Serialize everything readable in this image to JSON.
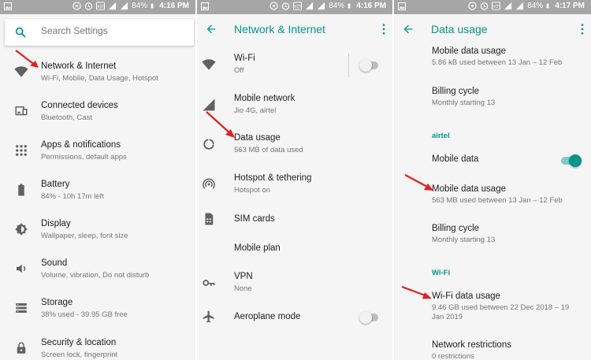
{
  "status": {
    "battery_p1": "84%",
    "time_p1": "4:16 PM",
    "battery_p2": "84%",
    "time_p2": "4:16 PM",
    "battery_p3": "84%",
    "time_p3": "4:17 PM"
  },
  "colors": {
    "accent": "#009688",
    "arrow": "#e02020",
    "statusbar": "#a6a6a6"
  },
  "settings": {
    "search_placeholder": "Search Settings",
    "items": [
      {
        "title": "Network & Internet",
        "subtitle": "Wi-Fi, Mobile, Data Usage, Hotspot",
        "icon": "wifi-icon"
      },
      {
        "title": "Connected devices",
        "subtitle": "Bluetooth, Cast",
        "icon": "devices-icon"
      },
      {
        "title": "Apps & notifications",
        "subtitle": "Permissions, default apps",
        "icon": "apps-grid-icon"
      },
      {
        "title": "Battery",
        "subtitle": "84% - 10h 17m left",
        "icon": "battery-icon"
      },
      {
        "title": "Display",
        "subtitle": "Wallpaper, sleep, font size",
        "icon": "brightness-icon"
      },
      {
        "title": "Sound",
        "subtitle": "Volume, vibration, Do not disturb",
        "icon": "volume-icon"
      },
      {
        "title": "Storage",
        "subtitle": "38% used - 39.95 GB free",
        "icon": "storage-icon"
      },
      {
        "title": "Security & location",
        "subtitle": "Screen lock, fingerprint",
        "icon": "lock-icon"
      }
    ]
  },
  "network": {
    "title": "Network & Internet",
    "items": [
      {
        "title": "Wi-Fi",
        "subtitle": "Off",
        "icon": "wifi-icon"
      },
      {
        "title": "Mobile network",
        "subtitle": "Jio 4G, airtel",
        "icon": "signal-icon"
      },
      {
        "title": "Data usage",
        "subtitle": "563 MB of data used",
        "icon": "data-usage-icon"
      },
      {
        "title": "Hotspot & tethering",
        "subtitle": "Hotspot on",
        "icon": "hotspot-icon"
      },
      {
        "title": "SIM cards",
        "subtitle": "",
        "icon": "sim-card-icon"
      },
      {
        "title": "Mobile plan",
        "subtitle": "",
        "icon": ""
      },
      {
        "title": "VPN",
        "subtitle": "None",
        "icon": "vpn-key-icon"
      },
      {
        "title": "Aeroplane mode",
        "subtitle": "",
        "icon": "airplane-icon"
      }
    ]
  },
  "datausage": {
    "title": "Data usage",
    "top_item": {
      "title": "Mobile data usage",
      "subtitle": "5.86 kB used between 13 Jan – 12 Feb"
    },
    "billing1": {
      "title": "Billing cycle",
      "subtitle": "Monthly starting 13"
    },
    "section_airtel": "airtel",
    "mobile_data": {
      "title": "Mobile data"
    },
    "mobile_usage": {
      "title": "Mobile data usage",
      "subtitle": "563 MB used between 13 Jan – 12 Feb"
    },
    "billing2": {
      "title": "Billing cycle",
      "subtitle": "Monthly starting 13"
    },
    "section_wifi": "Wi-Fi",
    "wifi_usage": {
      "title": "Wi-Fi data usage",
      "subtitle": "9.46 GB used between 22 Dec 2018 – 19 Jan 2019"
    },
    "restrictions": {
      "title": "Network restrictions",
      "subtitle": "0 restrictions"
    }
  }
}
